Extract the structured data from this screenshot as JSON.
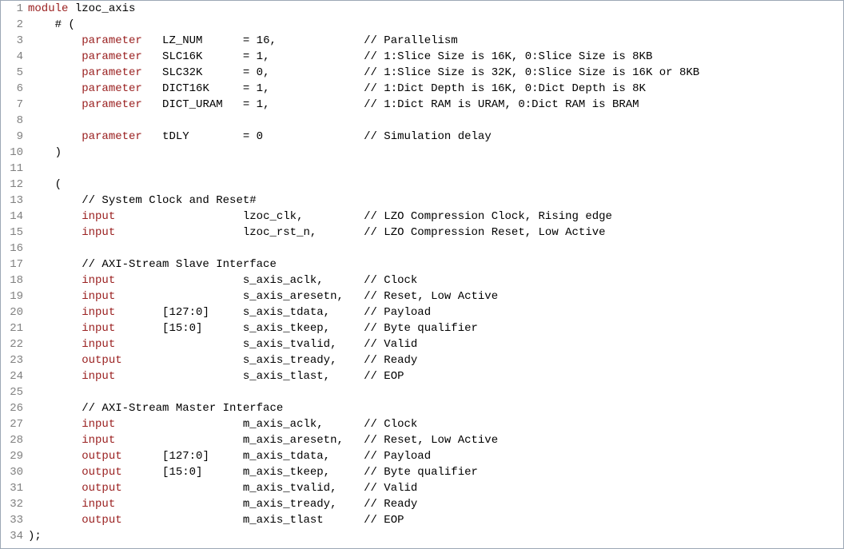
{
  "lines": [
    {
      "n": 1,
      "segs": [
        {
          "cls": "kw",
          "t": "module "
        },
        {
          "cls": "name",
          "t": "lzoc_axis"
        }
      ]
    },
    {
      "n": 2,
      "segs": [
        {
          "cls": "",
          "t": "    # ("
        }
      ]
    },
    {
      "n": 3,
      "segs": [
        {
          "cls": "",
          "t": "        "
        },
        {
          "cls": "kw",
          "t": "parameter"
        },
        {
          "cls": "",
          "t": "   LZ_NUM      = 16,             // Parallelism"
        }
      ]
    },
    {
      "n": 4,
      "segs": [
        {
          "cls": "",
          "t": "        "
        },
        {
          "cls": "kw",
          "t": "parameter"
        },
        {
          "cls": "",
          "t": "   SLC16K      = 1,              // 1:Slice Size is 16K, 0:Slice Size is 8KB"
        }
      ]
    },
    {
      "n": 5,
      "segs": [
        {
          "cls": "",
          "t": "        "
        },
        {
          "cls": "kw",
          "t": "parameter"
        },
        {
          "cls": "",
          "t": "   SLC32K      = 0,              // 1:Slice Size is 32K, 0:Slice Size is 16K or 8KB"
        }
      ]
    },
    {
      "n": 6,
      "segs": [
        {
          "cls": "",
          "t": "        "
        },
        {
          "cls": "kw",
          "t": "parameter"
        },
        {
          "cls": "",
          "t": "   DICT16K     = 1,              // 1:Dict Depth is 16K, 0:Dict Depth is 8K"
        }
      ]
    },
    {
      "n": 7,
      "segs": [
        {
          "cls": "",
          "t": "        "
        },
        {
          "cls": "kw",
          "t": "parameter"
        },
        {
          "cls": "",
          "t": "   DICT_URAM   = 1,              // 1:Dict RAM is URAM, 0:Dict RAM is BRAM"
        }
      ]
    },
    {
      "n": 8,
      "segs": [
        {
          "cls": "",
          "t": ""
        }
      ]
    },
    {
      "n": 9,
      "segs": [
        {
          "cls": "",
          "t": "        "
        },
        {
          "cls": "kw",
          "t": "parameter"
        },
        {
          "cls": "",
          "t": "   tDLY        = 0               // Simulation delay"
        }
      ]
    },
    {
      "n": 10,
      "segs": [
        {
          "cls": "",
          "t": "    )"
        }
      ]
    },
    {
      "n": 11,
      "segs": [
        {
          "cls": "",
          "t": ""
        }
      ]
    },
    {
      "n": 12,
      "segs": [
        {
          "cls": "",
          "t": "    ("
        }
      ]
    },
    {
      "n": 13,
      "segs": [
        {
          "cls": "",
          "t": "        // System Clock and Reset#"
        }
      ]
    },
    {
      "n": 14,
      "segs": [
        {
          "cls": "",
          "t": "        "
        },
        {
          "cls": "kw",
          "t": "input"
        },
        {
          "cls": "",
          "t": "                   lzoc_clk,         // LZO Compression Clock, Rising edge"
        }
      ]
    },
    {
      "n": 15,
      "segs": [
        {
          "cls": "",
          "t": "        "
        },
        {
          "cls": "kw",
          "t": "input"
        },
        {
          "cls": "",
          "t": "                   lzoc_rst_n,       // LZO Compression Reset, Low Active"
        }
      ]
    },
    {
      "n": 16,
      "segs": [
        {
          "cls": "",
          "t": ""
        }
      ]
    },
    {
      "n": 17,
      "segs": [
        {
          "cls": "",
          "t": "        // AXI-Stream Slave Interface"
        }
      ]
    },
    {
      "n": 18,
      "segs": [
        {
          "cls": "",
          "t": "        "
        },
        {
          "cls": "kw",
          "t": "input"
        },
        {
          "cls": "",
          "t": "                   s_axis_aclk,      // Clock"
        }
      ]
    },
    {
      "n": 19,
      "segs": [
        {
          "cls": "",
          "t": "        "
        },
        {
          "cls": "kw",
          "t": "input"
        },
        {
          "cls": "",
          "t": "                   s_axis_aresetn,   // Reset, Low Active"
        }
      ]
    },
    {
      "n": 20,
      "segs": [
        {
          "cls": "",
          "t": "        "
        },
        {
          "cls": "kw",
          "t": "input"
        },
        {
          "cls": "",
          "t": "       [127:0]     s_axis_tdata,     // Payload"
        }
      ]
    },
    {
      "n": 21,
      "segs": [
        {
          "cls": "",
          "t": "        "
        },
        {
          "cls": "kw",
          "t": "input"
        },
        {
          "cls": "",
          "t": "       [15:0]      s_axis_tkeep,     // Byte qualifier"
        }
      ]
    },
    {
      "n": 22,
      "segs": [
        {
          "cls": "",
          "t": "        "
        },
        {
          "cls": "kw",
          "t": "input"
        },
        {
          "cls": "",
          "t": "                   s_axis_tvalid,    // Valid"
        }
      ]
    },
    {
      "n": 23,
      "segs": [
        {
          "cls": "",
          "t": "        "
        },
        {
          "cls": "kw",
          "t": "output"
        },
        {
          "cls": "",
          "t": "                  s_axis_tready,    // Ready"
        }
      ]
    },
    {
      "n": 24,
      "segs": [
        {
          "cls": "",
          "t": "        "
        },
        {
          "cls": "kw",
          "t": "input"
        },
        {
          "cls": "",
          "t": "                   s_axis_tlast,     // EOP"
        }
      ]
    },
    {
      "n": 25,
      "segs": [
        {
          "cls": "",
          "t": ""
        }
      ]
    },
    {
      "n": 26,
      "segs": [
        {
          "cls": "",
          "t": "        // AXI-Stream Master Interface"
        }
      ]
    },
    {
      "n": 27,
      "segs": [
        {
          "cls": "",
          "t": "        "
        },
        {
          "cls": "kw",
          "t": "input"
        },
        {
          "cls": "",
          "t": "                   m_axis_aclk,      // Clock"
        }
      ]
    },
    {
      "n": 28,
      "segs": [
        {
          "cls": "",
          "t": "        "
        },
        {
          "cls": "kw",
          "t": "input"
        },
        {
          "cls": "",
          "t": "                   m_axis_aresetn,   // Reset, Low Active"
        }
      ]
    },
    {
      "n": 29,
      "segs": [
        {
          "cls": "",
          "t": "        "
        },
        {
          "cls": "kw",
          "t": "output"
        },
        {
          "cls": "",
          "t": "      [127:0]     m_axis_tdata,     // Payload"
        }
      ]
    },
    {
      "n": 30,
      "segs": [
        {
          "cls": "",
          "t": "        "
        },
        {
          "cls": "kw",
          "t": "output"
        },
        {
          "cls": "",
          "t": "      [15:0]      m_axis_tkeep,     // Byte qualifier"
        }
      ]
    },
    {
      "n": 31,
      "segs": [
        {
          "cls": "",
          "t": "        "
        },
        {
          "cls": "kw",
          "t": "output"
        },
        {
          "cls": "",
          "t": "                  m_axis_tvalid,    // Valid"
        }
      ]
    },
    {
      "n": 32,
      "segs": [
        {
          "cls": "",
          "t": "        "
        },
        {
          "cls": "kw",
          "t": "input"
        },
        {
          "cls": "",
          "t": "                   m_axis_tready,    // Ready"
        }
      ]
    },
    {
      "n": 33,
      "segs": [
        {
          "cls": "",
          "t": "        "
        },
        {
          "cls": "kw",
          "t": "output"
        },
        {
          "cls": "",
          "t": "                  m_axis_tlast      // EOP"
        }
      ]
    },
    {
      "n": 34,
      "segs": [
        {
          "cls": "",
          "t": ");"
        }
      ]
    }
  ]
}
